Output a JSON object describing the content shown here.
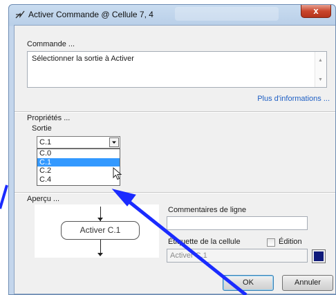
{
  "window": {
    "title": "Activer Commande @ Cellule 7, 4",
    "close_label": "x"
  },
  "command": {
    "group_label": "Commande ...",
    "text": "Sélectionner la sortie à Activer",
    "more_info_link": "Plus d'informations ..."
  },
  "properties": {
    "group_label": "Propriétés ...",
    "output_label": "Sortie",
    "selected_value": "C.1",
    "options": [
      "C.0",
      "C.1",
      "C.2",
      "C.4"
    ],
    "highlighted_option": "C.1"
  },
  "preview": {
    "group_label": "Aperçu ...",
    "flow_box_label": "Activer C.1"
  },
  "line_comments": {
    "label": "Commentaires de ligne",
    "value": ""
  },
  "cell_label": {
    "label": "Étiquette de la cellule",
    "value": "Activer C.1",
    "edit_label": "Édition",
    "edit_checked": false,
    "color": "#0f1a7a"
  },
  "buttons": {
    "ok_label": "OK",
    "cancel_label": "Annuler"
  },
  "annotation": {
    "arrow_color": "#1a2bff"
  }
}
